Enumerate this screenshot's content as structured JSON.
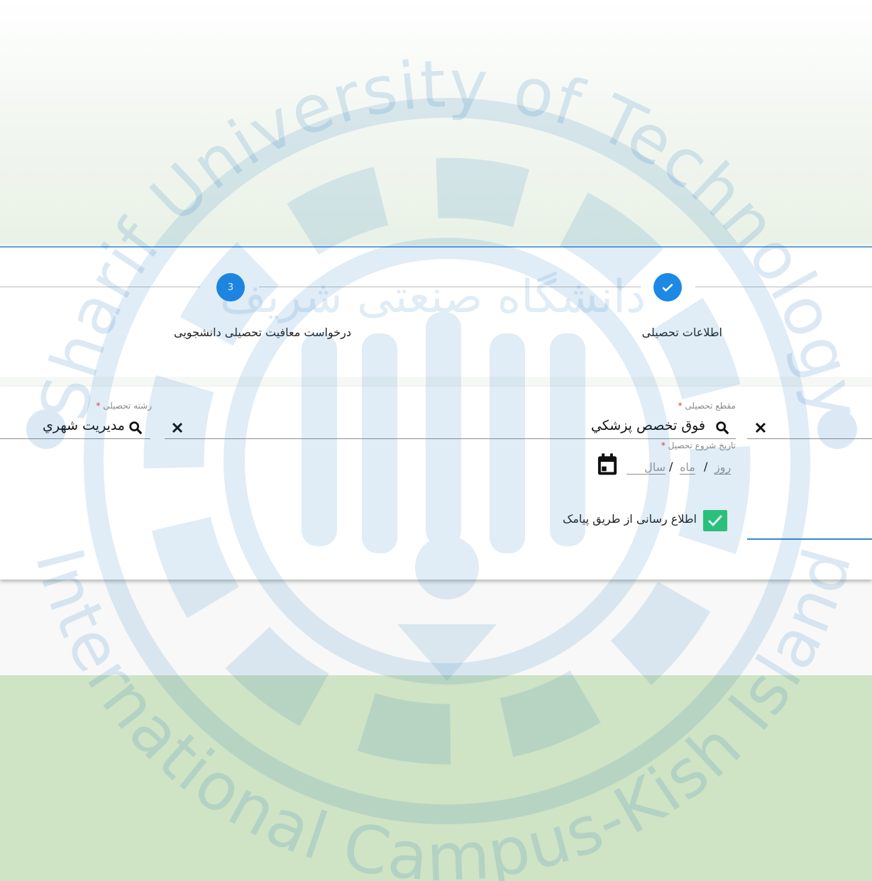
{
  "steps": [
    {
      "label": "اطلاعات تحصیلی",
      "status": "completed",
      "icon": "check-icon"
    },
    {
      "label": "درخواست معافیت تحصیلی دانشجویی",
      "status": "active",
      "number": "3"
    }
  ],
  "form": {
    "degree": {
      "label": "مقطع تحصیلی",
      "required_mark": "*",
      "value": "فوق تخصص پزشكي"
    },
    "major": {
      "label": "رشته تحصیلی",
      "required_mark": "*",
      "value": "مديريت شهري"
    },
    "start_date": {
      "label": "تاریخ شروع تحصیل",
      "required_mark": "*",
      "day_placeholder": "روز",
      "month_placeholder": "ماه",
      "year_placeholder": "سال",
      "separator": "/"
    },
    "sms": {
      "label": "اطلاع رسانی از طریق پیامک",
      "checked": true
    }
  },
  "watermark": {
    "outer_text_top": "Sharif University of Technology",
    "outer_text_bottom": "International Campus-Kish Island",
    "inner_text": "دانشگاه صنعتی شریف"
  },
  "colors": {
    "accent": "#1e88e5",
    "check": "#2ecc71",
    "bg_bottom": "#cfe3c5",
    "watermark": "#1b75bc"
  }
}
